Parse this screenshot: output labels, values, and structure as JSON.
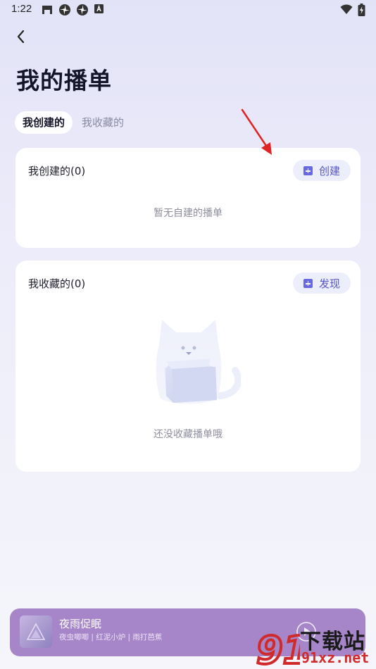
{
  "status_bar": {
    "time": "1:22",
    "icons": [
      "notification-app-icon",
      "pinwheel-icon",
      "pinwheel-icon",
      "keyboard-a-icon",
      "wifi-icon",
      "battery-charging-icon"
    ]
  },
  "header": {
    "back_icon": "chevron-left-icon",
    "title": "我的播单"
  },
  "tabs": [
    {
      "label": "我创建的",
      "active": true
    },
    {
      "label": "我收藏的",
      "active": false
    }
  ],
  "created_section": {
    "title": "我创建的(0)",
    "action_label": "创建",
    "action_icon": "plus-square-icon",
    "empty_text": "暂无自建的播单"
  },
  "favorites_section": {
    "title": "我收藏的(0)",
    "action_label": "发现",
    "action_icon": "plus-square-icon",
    "empty_text": "还没收藏播单哦",
    "illustration": "cat-holding-box-illustration"
  },
  "annotation": {
    "arrow_color": "#e02424"
  },
  "player": {
    "title": "夜雨促眠",
    "subtitle": "夜虫唧唧 | 红泥小炉 | 雨打芭蕉",
    "background": "#a686c8"
  },
  "watermark": {
    "logo_text": "91",
    "text_cn": "下载站",
    "url": "91xz.net"
  },
  "colors": {
    "accent": "#6868e0",
    "title": "#15152a",
    "muted": "#8e8e9e"
  }
}
